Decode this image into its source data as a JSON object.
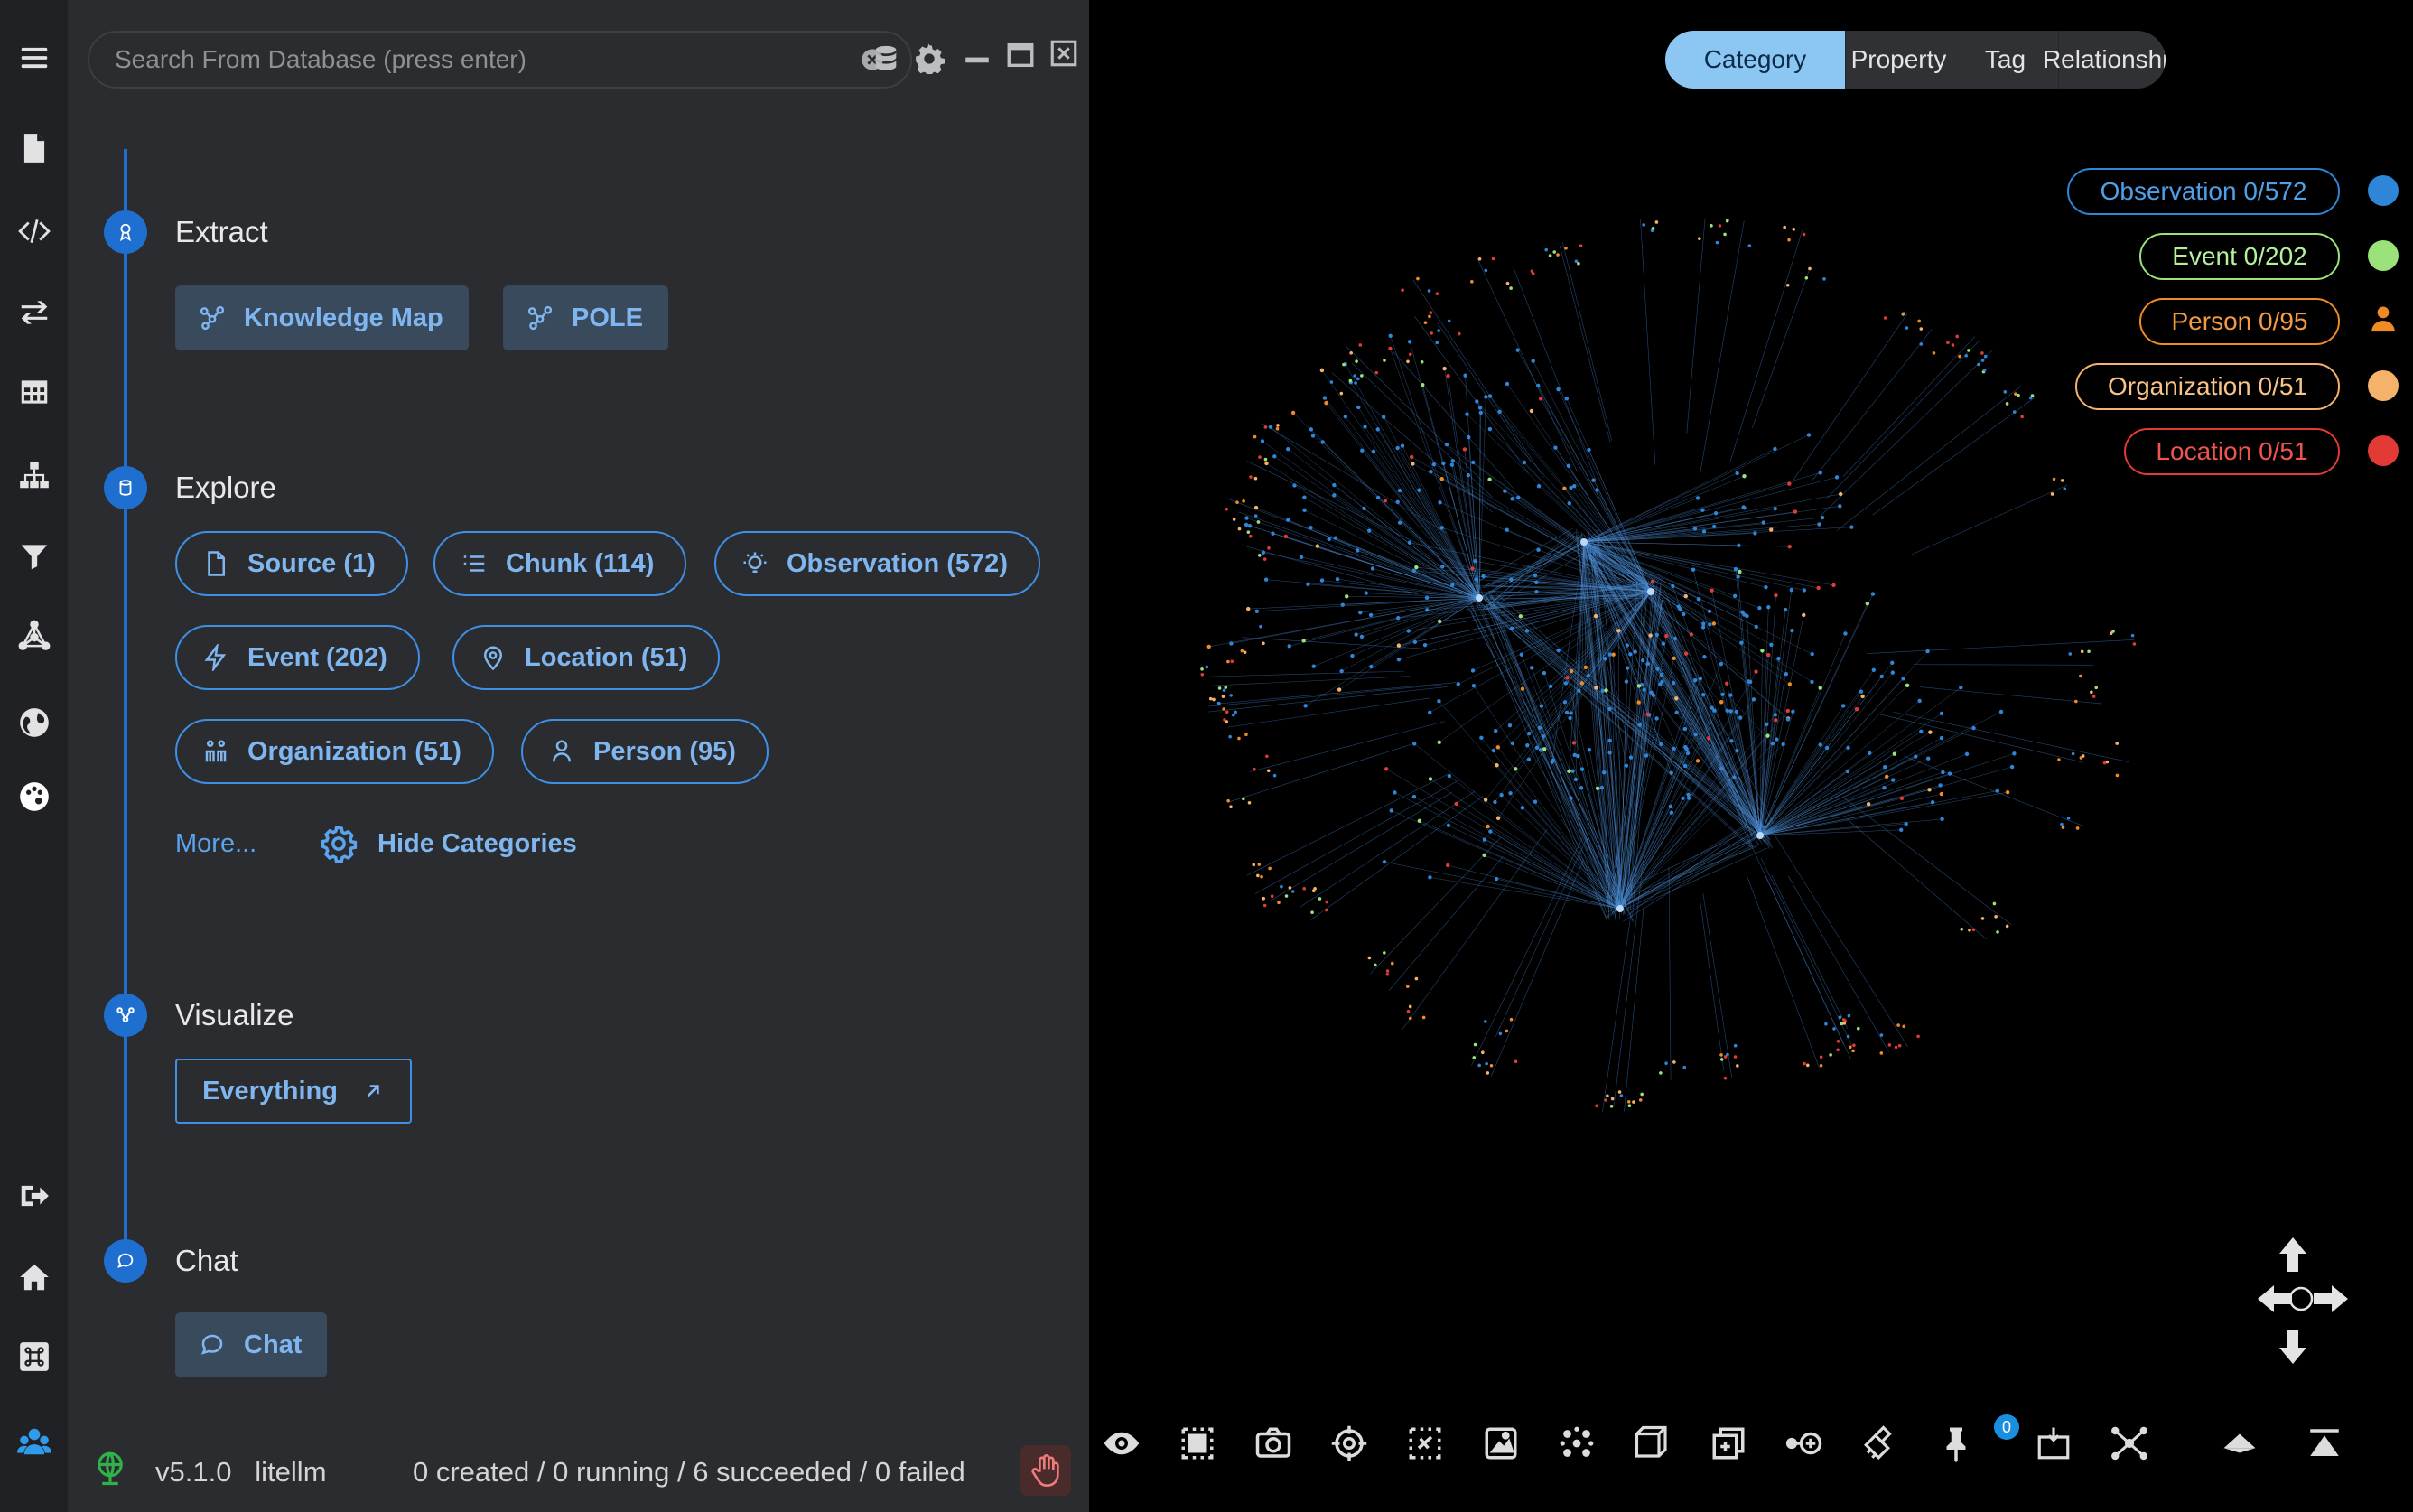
{
  "rail": {
    "icons": [
      "menu-icon",
      "file-icon",
      "code-icon",
      "transfer-icon",
      "table-icon",
      "sitemap-icon",
      "filter-icon",
      "graph-icon",
      "globe-icon",
      "palette-icon",
      "logout-icon",
      "home-icon",
      "command-icon",
      "users-icon"
    ]
  },
  "search": {
    "placeholder": "Search From Database (press enter)",
    "value": ""
  },
  "steps": {
    "extract": {
      "title": "Extract",
      "buttons": [
        "Knowledge Map",
        "POLE"
      ]
    },
    "explore": {
      "title": "Explore",
      "chips": [
        "Source (1)",
        "Chunk (114)",
        "Observation (572)",
        "Event (202)",
        "Location (51)",
        "Organization (51)",
        "Person (95)"
      ],
      "more": "More...",
      "hide": "Hide Categories"
    },
    "visualize": {
      "title": "Visualize",
      "button": "Everything"
    },
    "chat": {
      "title": "Chat",
      "button": "Chat"
    }
  },
  "footer": {
    "version": "v5.1.0",
    "model": "litellm",
    "jobs": "0 created / 0 running / 6 succeeded / 0 failed"
  },
  "graph": {
    "tabs": [
      "Category",
      "Property",
      "Tag",
      "Relationship"
    ],
    "active_tab": "Category",
    "legend": [
      {
        "label": "Observation 0/572",
        "color": "#2f86d8"
      },
      {
        "label": "Event 0/202",
        "color": "#9be27a"
      },
      {
        "label": "Person 0/95",
        "color": "#f08a24"
      },
      {
        "label": "Organization 0/51",
        "color": "#f5b26b"
      },
      {
        "label": "Location 0/51",
        "color": "#e23a35"
      }
    ],
    "pin_count": "0"
  }
}
